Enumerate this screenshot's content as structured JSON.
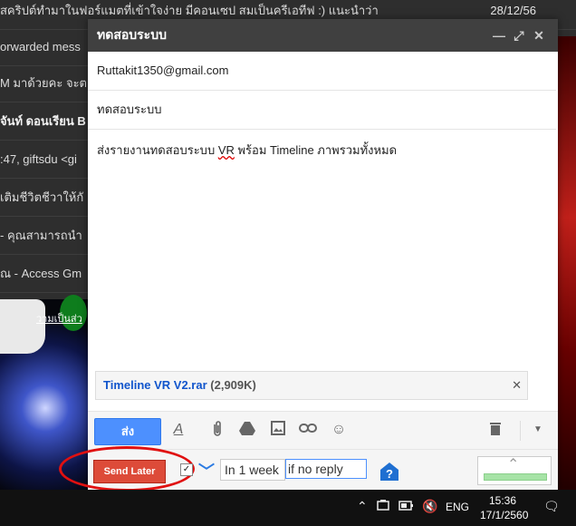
{
  "inbox": {
    "rows": [
      {
        "text": "สคริปต์ทำมาในฟอร์แมตที่เข้าใจง่าย มีคอนเซป สมเป็นครีเอทีฟ :) แนะนำว่า",
        "date": "28/12/56"
      },
      {
        "text": "orwarded mess",
        "date": ""
      },
      {
        "text": "M มาด้วยคะ จะต",
        "date": ""
      },
      {
        "text": "จันท์ ดอนเรียน B",
        "date": "",
        "bold": true
      },
      {
        "text": ":47, giftsdu <gi",
        "date": ""
      },
      {
        "text": "เติมชีวิตชีวาให้กั",
        "date": ""
      },
      {
        "text": "- คุณสามารถนำ",
        "date": ""
      },
      {
        "text": "ณ - Access Gm",
        "date": ""
      }
    ],
    "overlay_link": "วามเป็นส่ว"
  },
  "compose": {
    "title": "ทดสอบระบบ",
    "to": "Ruttakit1350@gmail.com",
    "subject": "ทดสอบระบบ",
    "body_before": "ส่งรายงานทดสอบระบบ ",
    "body_vr": "VR",
    "body_after": " พร้อม Timeline ภาพรวมทั้งหมด",
    "attachment": {
      "name": "Timeline VR V2.rar",
      "size": "(2,909K)"
    },
    "send_label": "ส่ง"
  },
  "send_later": {
    "button_label": "Send Later",
    "delay_value": "In 1 week",
    "condition_value": "if no reply",
    "checked": true
  },
  "taskbar": {
    "language": "ENG",
    "time": "15:36",
    "date": "17/1/2560"
  },
  "colors": {
    "send_blue": "#4d90fe",
    "send_later_red": "#dd4b39",
    "highlight_red": "#e01010",
    "header_dark": "#404040"
  },
  "icons": [
    "minimize-icon",
    "popout-icon",
    "close-icon",
    "format-text-icon",
    "attach-icon",
    "drive-icon",
    "photo-icon",
    "link-icon",
    "emoji-icon",
    "trash-icon",
    "more-options-icon",
    "help-icon",
    "chevron-up-icon"
  ]
}
